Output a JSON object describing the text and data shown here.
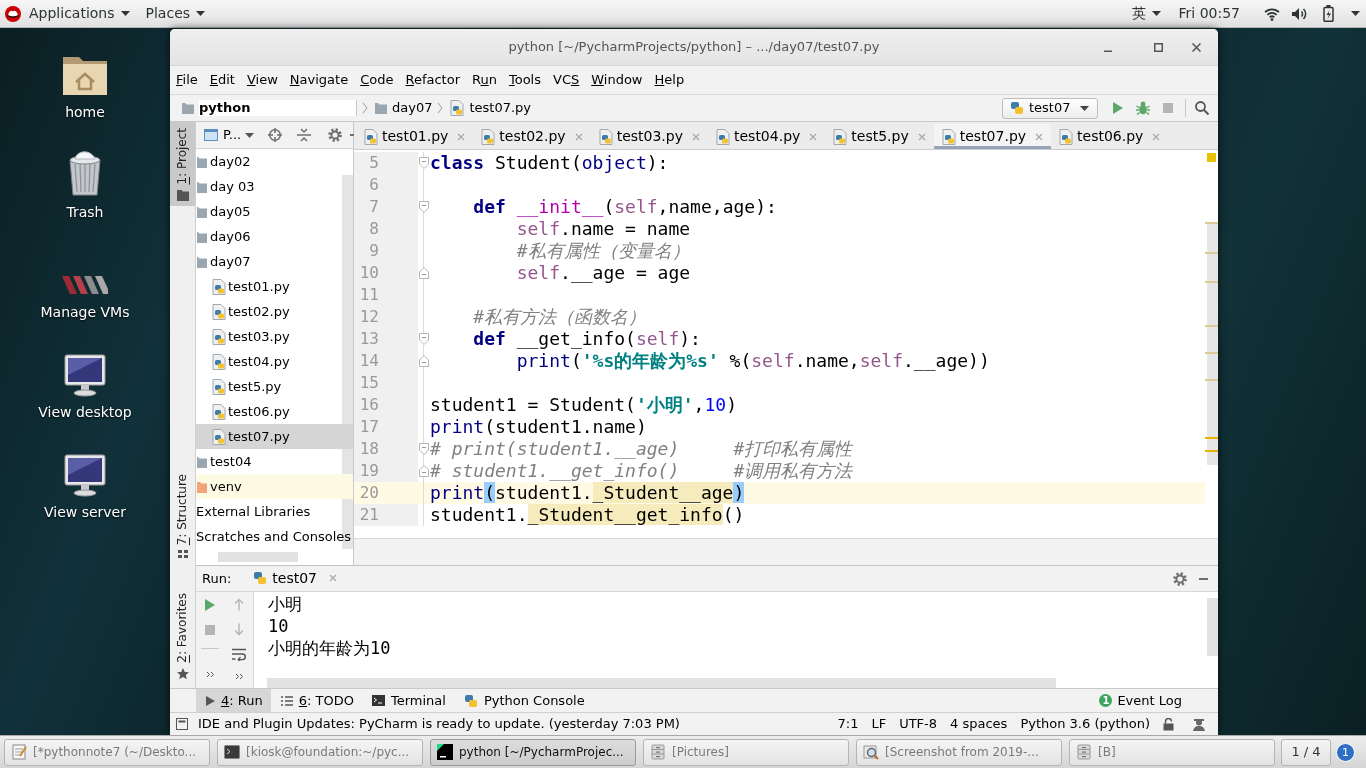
{
  "top_bar": {
    "menus": [
      {
        "label": "Applications"
      },
      {
        "label": "Places"
      }
    ],
    "input_method": "英",
    "clock": "Fri 00:57"
  },
  "desktop_icons": [
    {
      "kind": "home",
      "label": "home"
    },
    {
      "kind": "trash",
      "label": "Trash"
    },
    {
      "kind": "vm",
      "label": "Manage VMs"
    },
    {
      "kind": "monitor",
      "label": "View desktop"
    },
    {
      "kind": "monitor",
      "label": "View server"
    }
  ],
  "window": {
    "title": "python [~/PycharmProjects/python] – .../day07/test07.py"
  },
  "menu_bar": [
    {
      "key": "F",
      "post": "ile"
    },
    {
      "key": "E",
      "post": "dit"
    },
    {
      "key": "V",
      "post": "iew"
    },
    {
      "key": "N",
      "post": "avigate"
    },
    {
      "key": "C",
      "post": "ode"
    },
    {
      "key": "R",
      "post": "efactor"
    },
    {
      "pre": "R",
      "key": "u",
      "post": "n"
    },
    {
      "key": "T",
      "post": "ools"
    },
    {
      "pre": "VC",
      "key": "S"
    },
    {
      "key": "W",
      "post": "indow"
    },
    {
      "key": "H",
      "post": "elp"
    }
  ],
  "navigation_bar": {
    "breadcrumb": [
      {
        "kind": "project",
        "label": "python"
      },
      {
        "kind": "folder",
        "label": "day07"
      },
      {
        "kind": "pyfile",
        "label": "test07.py"
      }
    ],
    "run_config": "test07",
    "actions": [
      {
        "kind": "run",
        "disabled": false
      },
      {
        "kind": "debug",
        "disabled": false
      },
      {
        "kind": "stop",
        "disabled": true
      }
    ]
  },
  "tool_stripe": [
    {
      "kind": "project",
      "key": "1",
      "post": ": Project",
      "selected": true
    },
    {
      "kind": "structure",
      "key": "7",
      "post": ": Structure",
      "selected": false
    },
    {
      "kind": "favorites",
      "key": "2",
      "post": ": Favorites",
      "selected": false
    }
  ],
  "project_panel": {
    "view": "P...",
    "tree": [
      {
        "kind": "folder",
        "label": "day02",
        "selected": false
      },
      {
        "kind": "folder",
        "label": "day 03",
        "selected": false
      },
      {
        "kind": "folder",
        "label": "day05",
        "selected": false
      },
      {
        "kind": "folder",
        "label": "day06",
        "selected": false
      },
      {
        "kind": "folder",
        "label": "day07",
        "selected": false,
        "children": [
          {
            "kind": "pyfile",
            "label": "test01.py",
            "selected": false
          },
          {
            "kind": "pyfile",
            "label": "test02.py",
            "selected": false
          },
          {
            "kind": "pyfile",
            "label": "test03.py",
            "selected": false
          },
          {
            "kind": "pyfile",
            "label": "test04.py",
            "selected": false
          },
          {
            "kind": "pyfile",
            "label": "test5.py",
            "selected": false
          },
          {
            "kind": "pyfile",
            "label": "test06.py",
            "selected": false
          },
          {
            "kind": "pyfile",
            "label": "test07.py",
            "selected": true
          }
        ]
      },
      {
        "kind": "folder",
        "label": "test04",
        "selected": false
      },
      {
        "kind": "excluded",
        "label": "venv",
        "selected": false
      },
      {
        "kind": "library",
        "label": "External Libraries",
        "selected": false
      },
      {
        "kind": "scratches",
        "label": "Scratches and Consoles",
        "selected": false
      }
    ]
  },
  "editor": {
    "tabs": [
      {
        "label": "test01.py",
        "selected": false
      },
      {
        "label": "test02.py",
        "selected": false
      },
      {
        "label": "test03.py",
        "selected": false
      },
      {
        "label": "test04.py",
        "selected": false
      },
      {
        "label": "test5.py",
        "selected": false
      },
      {
        "label": "test07.py",
        "selected": true
      },
      {
        "label": "test06.py",
        "selected": false
      }
    ],
    "lines": [
      {
        "number": "5",
        "current": false,
        "fold_start": true,
        "tokens": [
          {
            "kind": "keyword",
            "text": "class"
          },
          {
            "kind": "plain",
            "text": " Student("
          },
          {
            "kind": "builtin",
            "text": "object"
          },
          {
            "kind": "plain",
            "text": "):"
          }
        ]
      },
      {
        "number": "6",
        "current": false
      },
      {
        "number": "7",
        "current": false,
        "fold_start": true,
        "tokens": [
          {
            "kind": "keyword",
            "text": "    def"
          },
          {
            "kind": "magic",
            "text": " __init__"
          },
          {
            "kind": "plain",
            "text": "("
          },
          {
            "kind": "self",
            "text": "self"
          },
          {
            "kind": "plain",
            "text": ",name,age):"
          }
        ]
      },
      {
        "number": "8",
        "current": false,
        "tokens": [
          {
            "kind": "self",
            "text": "        self"
          },
          {
            "kind": "plain",
            "text": ".name = name"
          }
        ]
      },
      {
        "number": "9",
        "current": false,
        "tokens": [
          {
            "kind": "comment",
            "text": "        #私有属性（变量名）"
          }
        ]
      },
      {
        "number": "10",
        "current": false,
        "fold_end": true,
        "tokens": [
          {
            "kind": "self",
            "text": "        self"
          },
          {
            "kind": "plain",
            "text": ".__age = age"
          }
        ]
      },
      {
        "number": "11",
        "current": false
      },
      {
        "number": "12",
        "current": false,
        "tokens": [
          {
            "kind": "comment",
            "text": "    #私有方法（函数名）"
          }
        ]
      },
      {
        "number": "13",
        "current": false,
        "fold_start": true,
        "tokens": [
          {
            "kind": "keyword",
            "text": "    def"
          },
          {
            "kind": "plain",
            "text": " __get_info("
          },
          {
            "kind": "self",
            "text": "self"
          },
          {
            "kind": "plain",
            "text": "):"
          }
        ]
      },
      {
        "number": "14",
        "current": false,
        "fold_end": true,
        "tokens": [
          {
            "kind": "builtin",
            "text": "        print"
          },
          {
            "kind": "plain",
            "text": "("
          },
          {
            "kind": "string",
            "text": "'%s的年龄为%s'"
          },
          {
            "kind": "plain",
            "text": " %("
          },
          {
            "kind": "self",
            "text": "self"
          },
          {
            "kind": "plain",
            "text": ".name,"
          },
          {
            "kind": "self",
            "text": "self"
          },
          {
            "kind": "plain",
            "text": ".__age))"
          }
        ]
      },
      {
        "number": "15",
        "current": false
      },
      {
        "number": "16",
        "current": false,
        "tokens": [
          {
            "kind": "plain",
            "text": "student1 = Student("
          },
          {
            "kind": "string",
            "text": "'小明'"
          },
          {
            "kind": "plain",
            "text": ","
          },
          {
            "kind": "number",
            "text": "10"
          },
          {
            "kind": "plain",
            "text": ")"
          }
        ]
      },
      {
        "number": "17",
        "current": false,
        "tokens": [
          {
            "kind": "builtin",
            "text": "print"
          },
          {
            "kind": "plain",
            "text": "(student1.name)"
          }
        ]
      },
      {
        "number": "18",
        "current": false,
        "fold_start": true,
        "tokens": [
          {
            "kind": "comment",
            "text": "# print(student1.__age)     #打印私有属性"
          }
        ]
      },
      {
        "number": "19",
        "current": false,
        "fold_end": true,
        "tokens": [
          {
            "kind": "comment",
            "text": "# student1.__get_info()     #调用私有方法"
          }
        ]
      },
      {
        "number": "20",
        "current": true,
        "tokens": [
          {
            "kind": "builtin",
            "text": "print"
          },
          {
            "kind": "brace_match",
            "text": "("
          },
          {
            "kind": "plain",
            "text": "student1."
          },
          {
            "kind": "usage",
            "text": "_Student__age"
          },
          {
            "kind": "brace_match",
            "text": ")"
          }
        ]
      },
      {
        "number": "21",
        "current": false,
        "tokens": [
          {
            "kind": "plain",
            "text": "student1."
          },
          {
            "kind": "usage",
            "text": "_Student__get_info"
          },
          {
            "kind": "plain",
            "text": "()"
          }
        ]
      }
    ]
  },
  "run_panel": {
    "title": "Run:",
    "tab": "test07",
    "toolbar_left": [
      {
        "kind": "rerun",
        "disabled": false
      },
      {
        "kind": "stop",
        "disabled": true
      }
    ],
    "toolbar_right": [
      {
        "kind": "up",
        "disabled": true
      },
      {
        "kind": "down",
        "disabled": true
      },
      {
        "kind": "wrap",
        "disabled": false
      }
    ],
    "output": [
      "小明",
      "10",
      "小明的年龄为10"
    ]
  },
  "bottom_tabs": [
    {
      "kind": "run",
      "key": "4",
      "post": ": Run",
      "selected": true
    },
    {
      "kind": "todo",
      "key": "6",
      "post": ": TODO",
      "selected": false
    },
    {
      "kind": "terminal",
      "label": "Terminal",
      "selected": false
    },
    {
      "kind": "console",
      "label": "Python Console",
      "selected": false
    }
  ],
  "event_log": {
    "label": "Event Log",
    "count": "1"
  },
  "status_bar": {
    "message": "IDE and Plugin Updates: PyCharm is ready to update. (yesterday 7:03 PM)",
    "fields": [
      "7:1",
      "LF",
      "UTF-8",
      "4 spaces",
      "Python 3.6 (python)"
    ]
  },
  "taskbar": {
    "items": [
      {
        "kind": "notepad",
        "label": "[*pythonnote7 (~/Deskto...",
        "selected": false
      },
      {
        "kind": "terminal",
        "label": "[kiosk@foundation:~/pyc...",
        "selected": false
      },
      {
        "kind": "pycharm",
        "label": "python [~/PycharmProjec...",
        "selected": true
      },
      {
        "kind": "files",
        "label": "[Pictures]",
        "selected": false
      },
      {
        "kind": "viewer",
        "label": "[Screenshot from 2019-...",
        "selected": false
      },
      {
        "kind": "files",
        "label": "[B]",
        "selected": false
      }
    ],
    "pager": "1 / 4",
    "notifications": "1"
  }
}
